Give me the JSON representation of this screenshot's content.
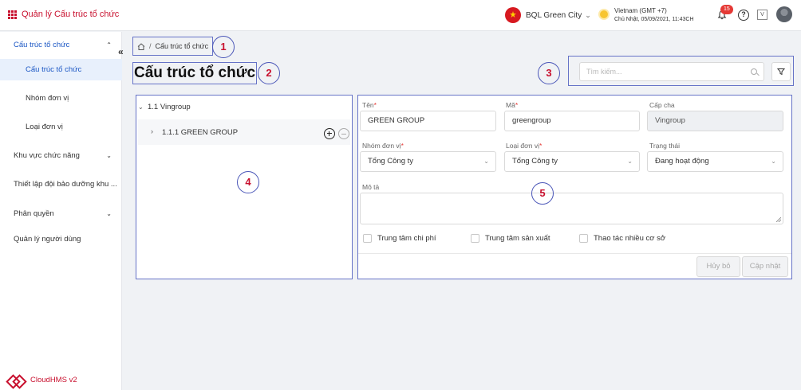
{
  "app": {
    "title": "Quản lý Cấu trúc tổ chức"
  },
  "header": {
    "org_name": "BQL Green City",
    "timezone": "Vietnam (GMT +7)",
    "datetime": "Chủ Nhật, 05/09/2021, 11:43CH",
    "notification_count": "15",
    "help_label": "?",
    "lang_label": "V"
  },
  "sidebar": {
    "items": [
      {
        "label": "Cấu trúc tổ chức",
        "expanded": true
      },
      {
        "label": "Cấu trúc tổ chức",
        "active": true
      },
      {
        "label": "Nhóm đơn vị"
      },
      {
        "label": "Loại đơn vị"
      },
      {
        "label": "Khu vực chức năng"
      },
      {
        "label": "Thiết lập đội bảo dưỡng khu ..."
      },
      {
        "label": "Phân quyền"
      },
      {
        "label": "Quản lý người dùng"
      }
    ],
    "collapse_label": "«",
    "footer": "CloudHMS v2"
  },
  "breadcrumb": {
    "current": "Cấu trúc tổ chức",
    "separator": "/"
  },
  "page": {
    "title": "Cấu trúc tổ chức"
  },
  "search": {
    "placeholder": "Tìm kiếm...",
    "value": ""
  },
  "callouts": [
    "1",
    "2",
    "3",
    "4",
    "5"
  ],
  "tree": {
    "root": "1.1 Vingroup",
    "children": [
      {
        "label": "1.1.1 GREEN GROUP"
      }
    ]
  },
  "form": {
    "name_label": "Tên",
    "name_value": "GREEN GROUP",
    "code_label": "Mã",
    "code_value": "greengroup",
    "parent_label": "Cấp cha",
    "parent_value": "Vingroup",
    "unit_group_label": "Nhóm đơn vị",
    "unit_group_value": "Tổng Công ty",
    "unit_type_label": "Loại đơn vị",
    "unit_type_value": "Tổng Công ty",
    "status_label": "Trạng thái",
    "status_value": "Đang hoạt động",
    "desc_label": "Mô tả",
    "desc_value": "",
    "required_mark": "*",
    "checkboxes": [
      {
        "label": "Trung tâm chi phí",
        "checked": false
      },
      {
        "label": "Trung tâm sản xuất",
        "checked": false
      },
      {
        "label": "Thao tác nhiều cơ sở",
        "checked": false
      }
    ],
    "cancel_label": "Hủy bỏ",
    "update_label": "Cập nhật"
  },
  "colors": {
    "brand": "#c8102e",
    "active": "#1a56c4",
    "callout_border": "#4a56b8"
  }
}
